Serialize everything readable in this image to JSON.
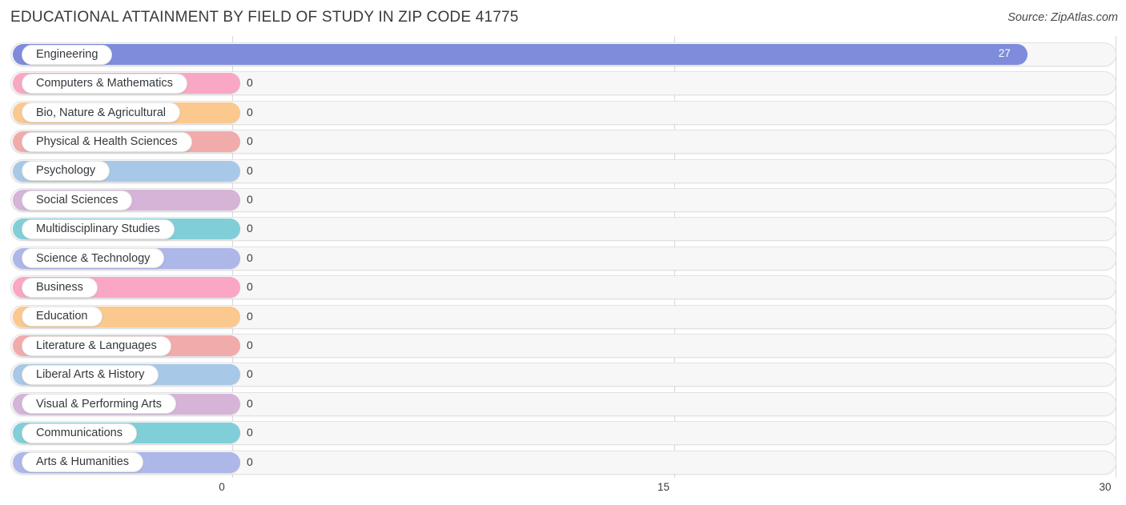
{
  "header": {
    "title": "EDUCATIONAL ATTAINMENT BY FIELD OF STUDY IN ZIP CODE 41775",
    "source": "Source: ZipAtlas.com"
  },
  "chart_data": {
    "type": "bar",
    "orientation": "horizontal",
    "title": "EDUCATIONAL ATTAINMENT BY FIELD OF STUDY IN ZIP CODE 41775",
    "subtitle": "",
    "xlabel": "",
    "ylabel": "",
    "xlim": [
      0,
      30
    ],
    "ticks": [
      "0",
      "15",
      "30"
    ],
    "tick_values": [
      0,
      15,
      30
    ],
    "grid": true,
    "legend": "none",
    "categories": [
      "Engineering",
      "Computers & Mathematics",
      "Bio, Nature & Agricultural",
      "Physical & Health Sciences",
      "Psychology",
      "Social Sciences",
      "Multidisciplinary Studies",
      "Science & Technology",
      "Business",
      "Education",
      "Literature & Languages",
      "Liberal Arts & History",
      "Visual & Performing Arts",
      "Communications",
      "Arts & Humanities"
    ],
    "values": [
      27,
      0,
      0,
      0,
      0,
      0,
      0,
      0,
      0,
      0,
      0,
      0,
      0,
      0,
      0
    ],
    "value_labels": [
      "27",
      "0",
      "0",
      "0",
      "0",
      "0",
      "0",
      "0",
      "0",
      "0",
      "0",
      "0",
      "0",
      "0",
      "0"
    ],
    "colors": [
      "#7e8cdb",
      "#f9a7c5",
      "#fbc88e",
      "#f2abab",
      "#a8c8e8",
      "#d5b4d8",
      "#80cfd8",
      "#adb7e8",
      "#f9a7c5",
      "#fbc88e",
      "#f2abab",
      "#a8c8e8",
      "#d5b4d8",
      "#80cfd8",
      "#adb7e8"
    ]
  },
  "axis": {
    "ticks": [
      {
        "label": "0",
        "value": 0
      },
      {
        "label": "15",
        "value": 15
      },
      {
        "label": "30",
        "value": 30
      }
    ]
  }
}
